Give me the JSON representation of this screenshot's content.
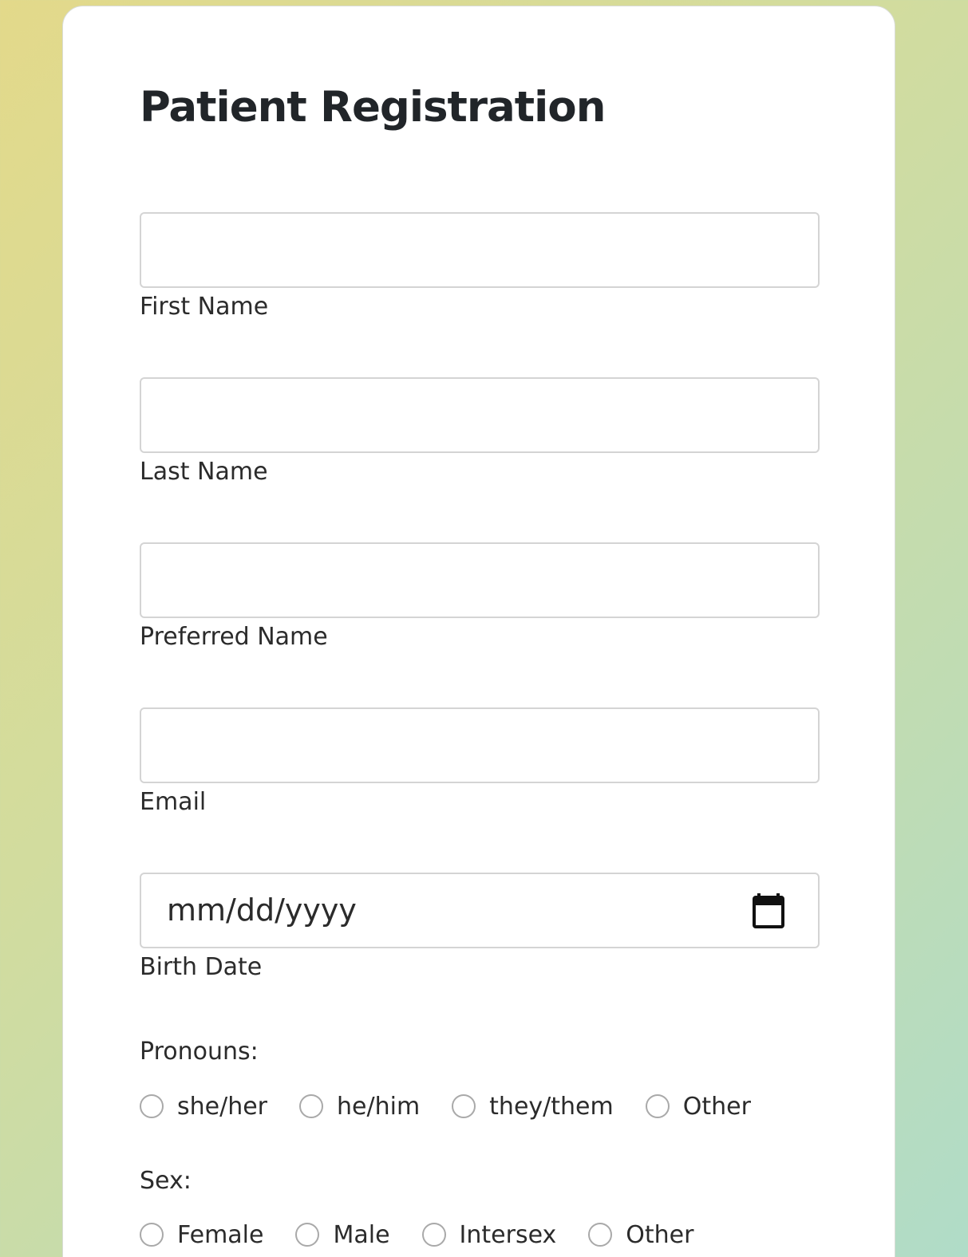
{
  "form": {
    "title": "Patient Registration",
    "fields": {
      "first_name": {
        "label": "First Name",
        "value": ""
      },
      "last_name": {
        "label": "Last Name",
        "value": ""
      },
      "preferred_name": {
        "label": "Preferred Name",
        "value": ""
      },
      "email": {
        "label": "Email",
        "value": ""
      },
      "birth_date": {
        "label": "Birth Date",
        "placeholder": "mm/dd/yyyy",
        "icon": "calendar-icon"
      }
    },
    "pronouns": {
      "label": "Pronouns:",
      "options": [
        "she/her",
        "he/him",
        "they/them",
        "Other"
      ],
      "selected": null
    },
    "sex": {
      "label": "Sex:",
      "options": [
        "Female",
        "Male",
        "Intersex",
        "Other"
      ],
      "selected": null
    }
  },
  "colors": {
    "background_gradient": [
      "#e3d98a",
      "#b0dcc8"
    ],
    "card": "#ffffff",
    "input_border": "#d4d4d4",
    "text": "#2b2b2b"
  }
}
